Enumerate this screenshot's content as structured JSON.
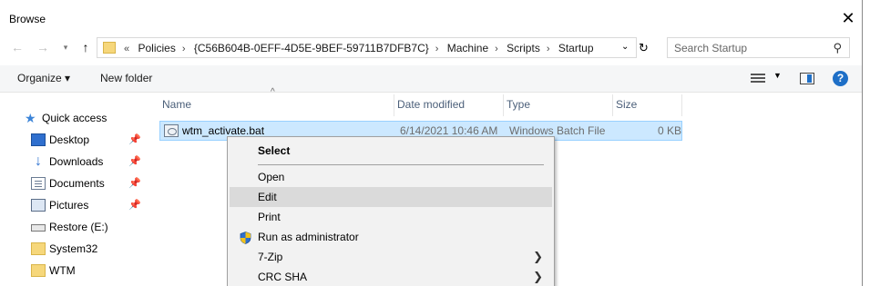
{
  "window": {
    "title": "Browse",
    "close_glyph": "✕"
  },
  "navigation": {
    "back_icon": "arrow-left-icon",
    "forward_icon": "arrow-right-icon",
    "up_icon": "arrow-up-icon",
    "breadcrumb_prefix": "«",
    "breadcrumbs": [
      "Policies",
      "{C56B604B-0EFF-4D5E-9BEF-59711B7DFB7C}",
      "Machine",
      "Scripts",
      "Startup"
    ],
    "search_placeholder": "Search Startup"
  },
  "toolbar": {
    "organize_label": "Organize ▾",
    "new_folder_label": "New folder",
    "help_label": "?"
  },
  "sidebar": {
    "items": [
      {
        "label": "Quick access",
        "icon": "star-icon"
      },
      {
        "label": "Desktop",
        "icon": "desktop-icon",
        "pinned": true
      },
      {
        "label": "Downloads",
        "icon": "download-icon",
        "pinned": true
      },
      {
        "label": "Documents",
        "icon": "documents-icon",
        "pinned": true
      },
      {
        "label": "Pictures",
        "icon": "pictures-icon",
        "pinned": true
      },
      {
        "label": "Restore (E:)",
        "icon": "drive-icon"
      },
      {
        "label": "System32",
        "icon": "folder-icon"
      },
      {
        "label": "WTM",
        "icon": "folder-icon"
      }
    ]
  },
  "columns": [
    "Name",
    "Date modified",
    "Type",
    "Size"
  ],
  "files": [
    {
      "name": "wtm_activate.bat",
      "date_modified": "6/14/2021 10:46 AM",
      "type": "Windows Batch File",
      "size": "0 KB"
    }
  ],
  "context_menu": {
    "items": [
      {
        "label": "Select",
        "bold": true
      },
      {
        "label": "Open"
      },
      {
        "label": "Edit",
        "highlighted": true
      },
      {
        "label": "Print"
      },
      {
        "label": "Run as administrator",
        "icon": "uac-shield-icon"
      },
      {
        "label": "7-Zip",
        "submenu": true
      },
      {
        "label": "CRC SHA",
        "submenu": true
      }
    ]
  },
  "colors": {
    "selection_bg": "#cce8ff",
    "selection_border": "#99d1ff",
    "menu_highlight": "#dadada",
    "accent": "#1e6fc7"
  }
}
